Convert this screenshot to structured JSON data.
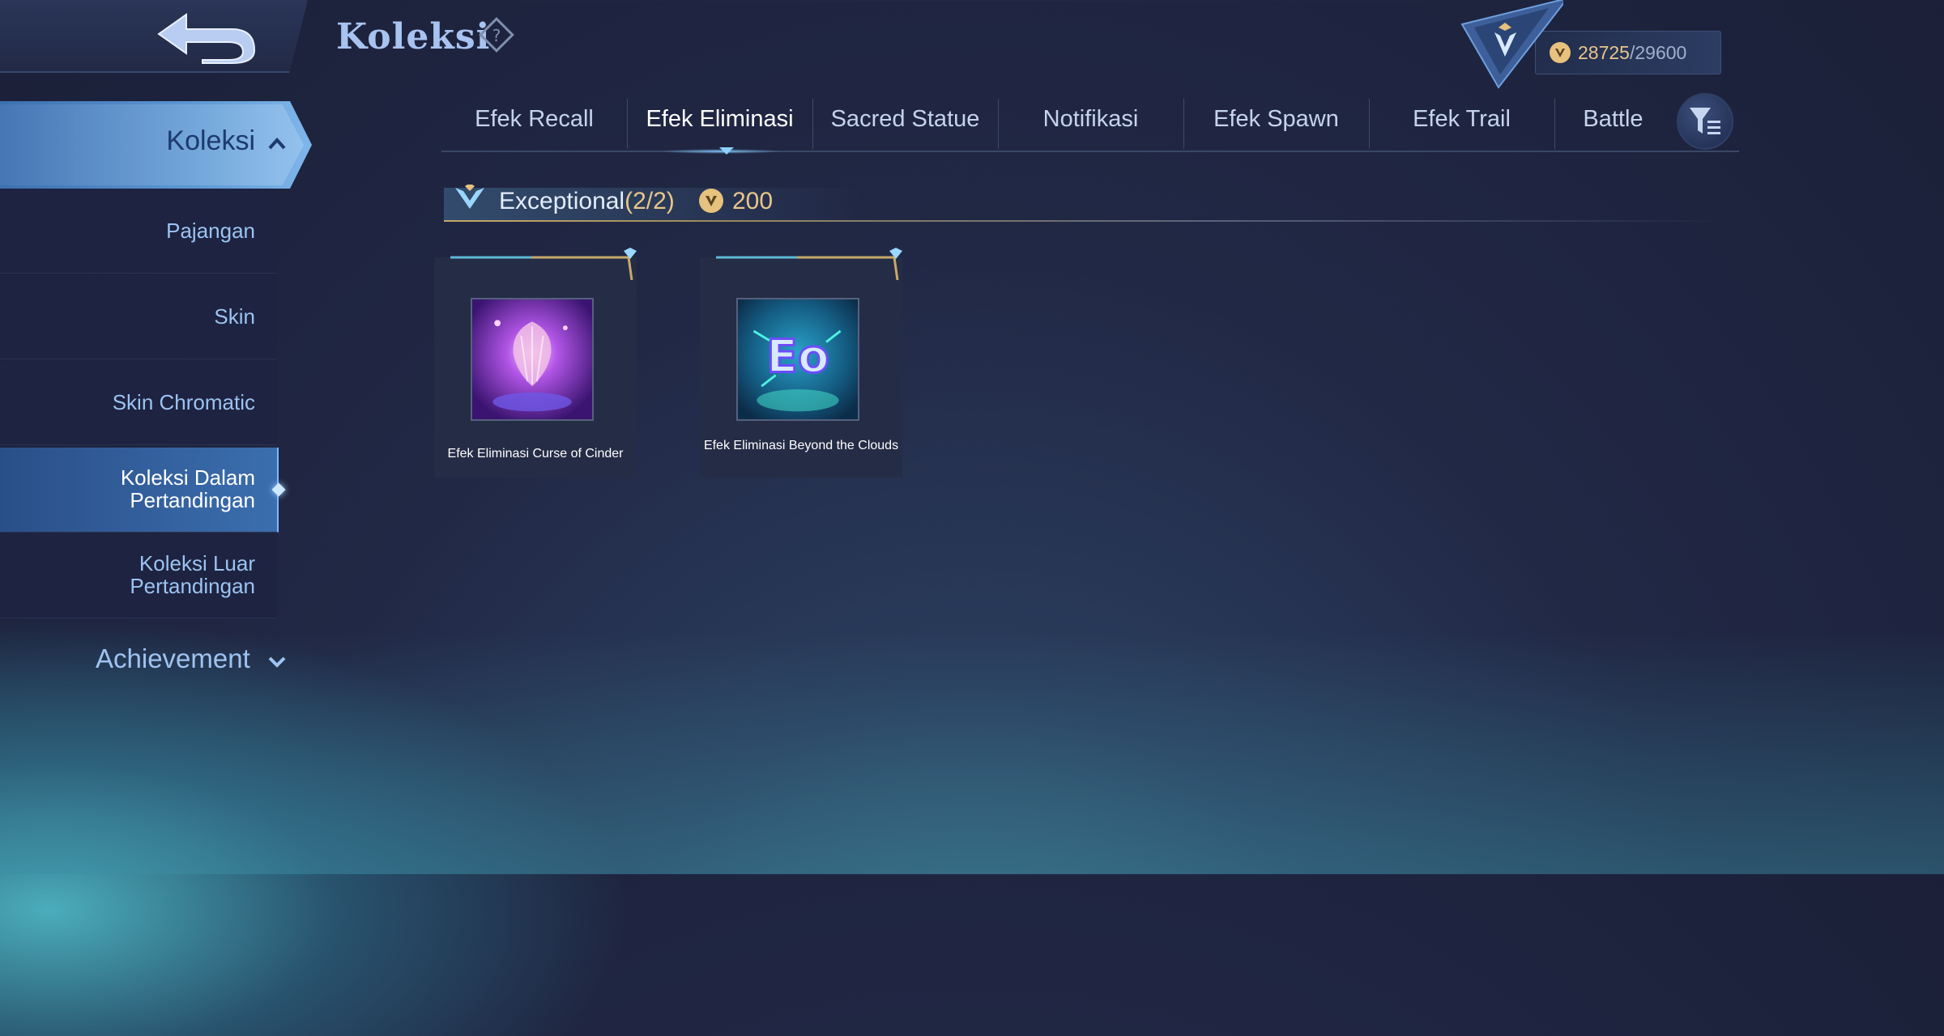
{
  "header": {
    "title": "Koleksi",
    "currency_current": "28725",
    "currency_max": "/29600"
  },
  "sidebar": {
    "active": "Koleksi",
    "items": [
      {
        "label": "Pajangan"
      },
      {
        "label": "Skin"
      },
      {
        "label": "Skin Chromatic"
      },
      {
        "label": "Koleksi Dalam Pertandingan",
        "selected": true
      },
      {
        "label": "Koleksi Luar Pertandingan"
      }
    ],
    "achievement": "Achievement"
  },
  "tabs": [
    {
      "label": "Efek Recall"
    },
    {
      "label": "Efek Eliminasi",
      "active": true
    },
    {
      "label": "Sacred Statue"
    },
    {
      "label": "Notifikasi"
    },
    {
      "label": "Efek Spawn"
    },
    {
      "label": "Efek Trail"
    },
    {
      "label": "Battle"
    }
  ],
  "section": {
    "title": "Exceptional",
    "count": "(2/2)",
    "price": "200"
  },
  "items": [
    {
      "name": "Efek Eliminasi Curse of Cinder"
    },
    {
      "name": "Efek Eliminasi Beyond the Clouds"
    }
  ],
  "colors": {
    "accent_gold": "#e8c68a",
    "accent_blue": "#5f9ad6",
    "background": "#212845"
  },
  "icons": [
    "back-arrow-icon",
    "help-diamond-icon",
    "rank-emblem-icon",
    "coin-icon",
    "chevron-up-icon",
    "chevron-down-icon",
    "filter-icon",
    "tier-icon"
  ]
}
